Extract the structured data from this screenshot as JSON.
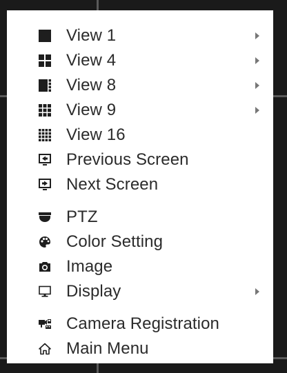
{
  "menu": {
    "items": [
      {
        "label": "View 1",
        "icon": "view-1-icon",
        "submenu": true
      },
      {
        "label": "View 4",
        "icon": "view-4-icon",
        "submenu": true
      },
      {
        "label": "View 8",
        "icon": "view-8-icon",
        "submenu": true
      },
      {
        "label": "View 9",
        "icon": "view-9-icon",
        "submenu": true
      },
      {
        "label": "View 16",
        "icon": "view-16-icon",
        "submenu": false
      },
      {
        "label": "Previous Screen",
        "icon": "previous-screen-icon",
        "submenu": false
      },
      {
        "label": "Next Screen",
        "icon": "next-screen-icon",
        "submenu": false
      },
      {
        "label": "PTZ",
        "icon": "ptz-camera-icon",
        "submenu": false
      },
      {
        "label": "Color Setting",
        "icon": "palette-icon",
        "submenu": false
      },
      {
        "label": "Image",
        "icon": "camera-icon",
        "submenu": false
      },
      {
        "label": "Display",
        "icon": "monitor-icon",
        "submenu": true
      },
      {
        "label": "Camera Registration",
        "icon": "camera-registration-icon",
        "submenu": false
      },
      {
        "label": "Main Menu",
        "icon": "home-icon",
        "submenu": false
      }
    ]
  },
  "colors": {
    "menu_background": "#ffffff",
    "text": "#2b2b2b",
    "icon": "#1e1e1e",
    "frame_background": "#1a1a1a"
  }
}
